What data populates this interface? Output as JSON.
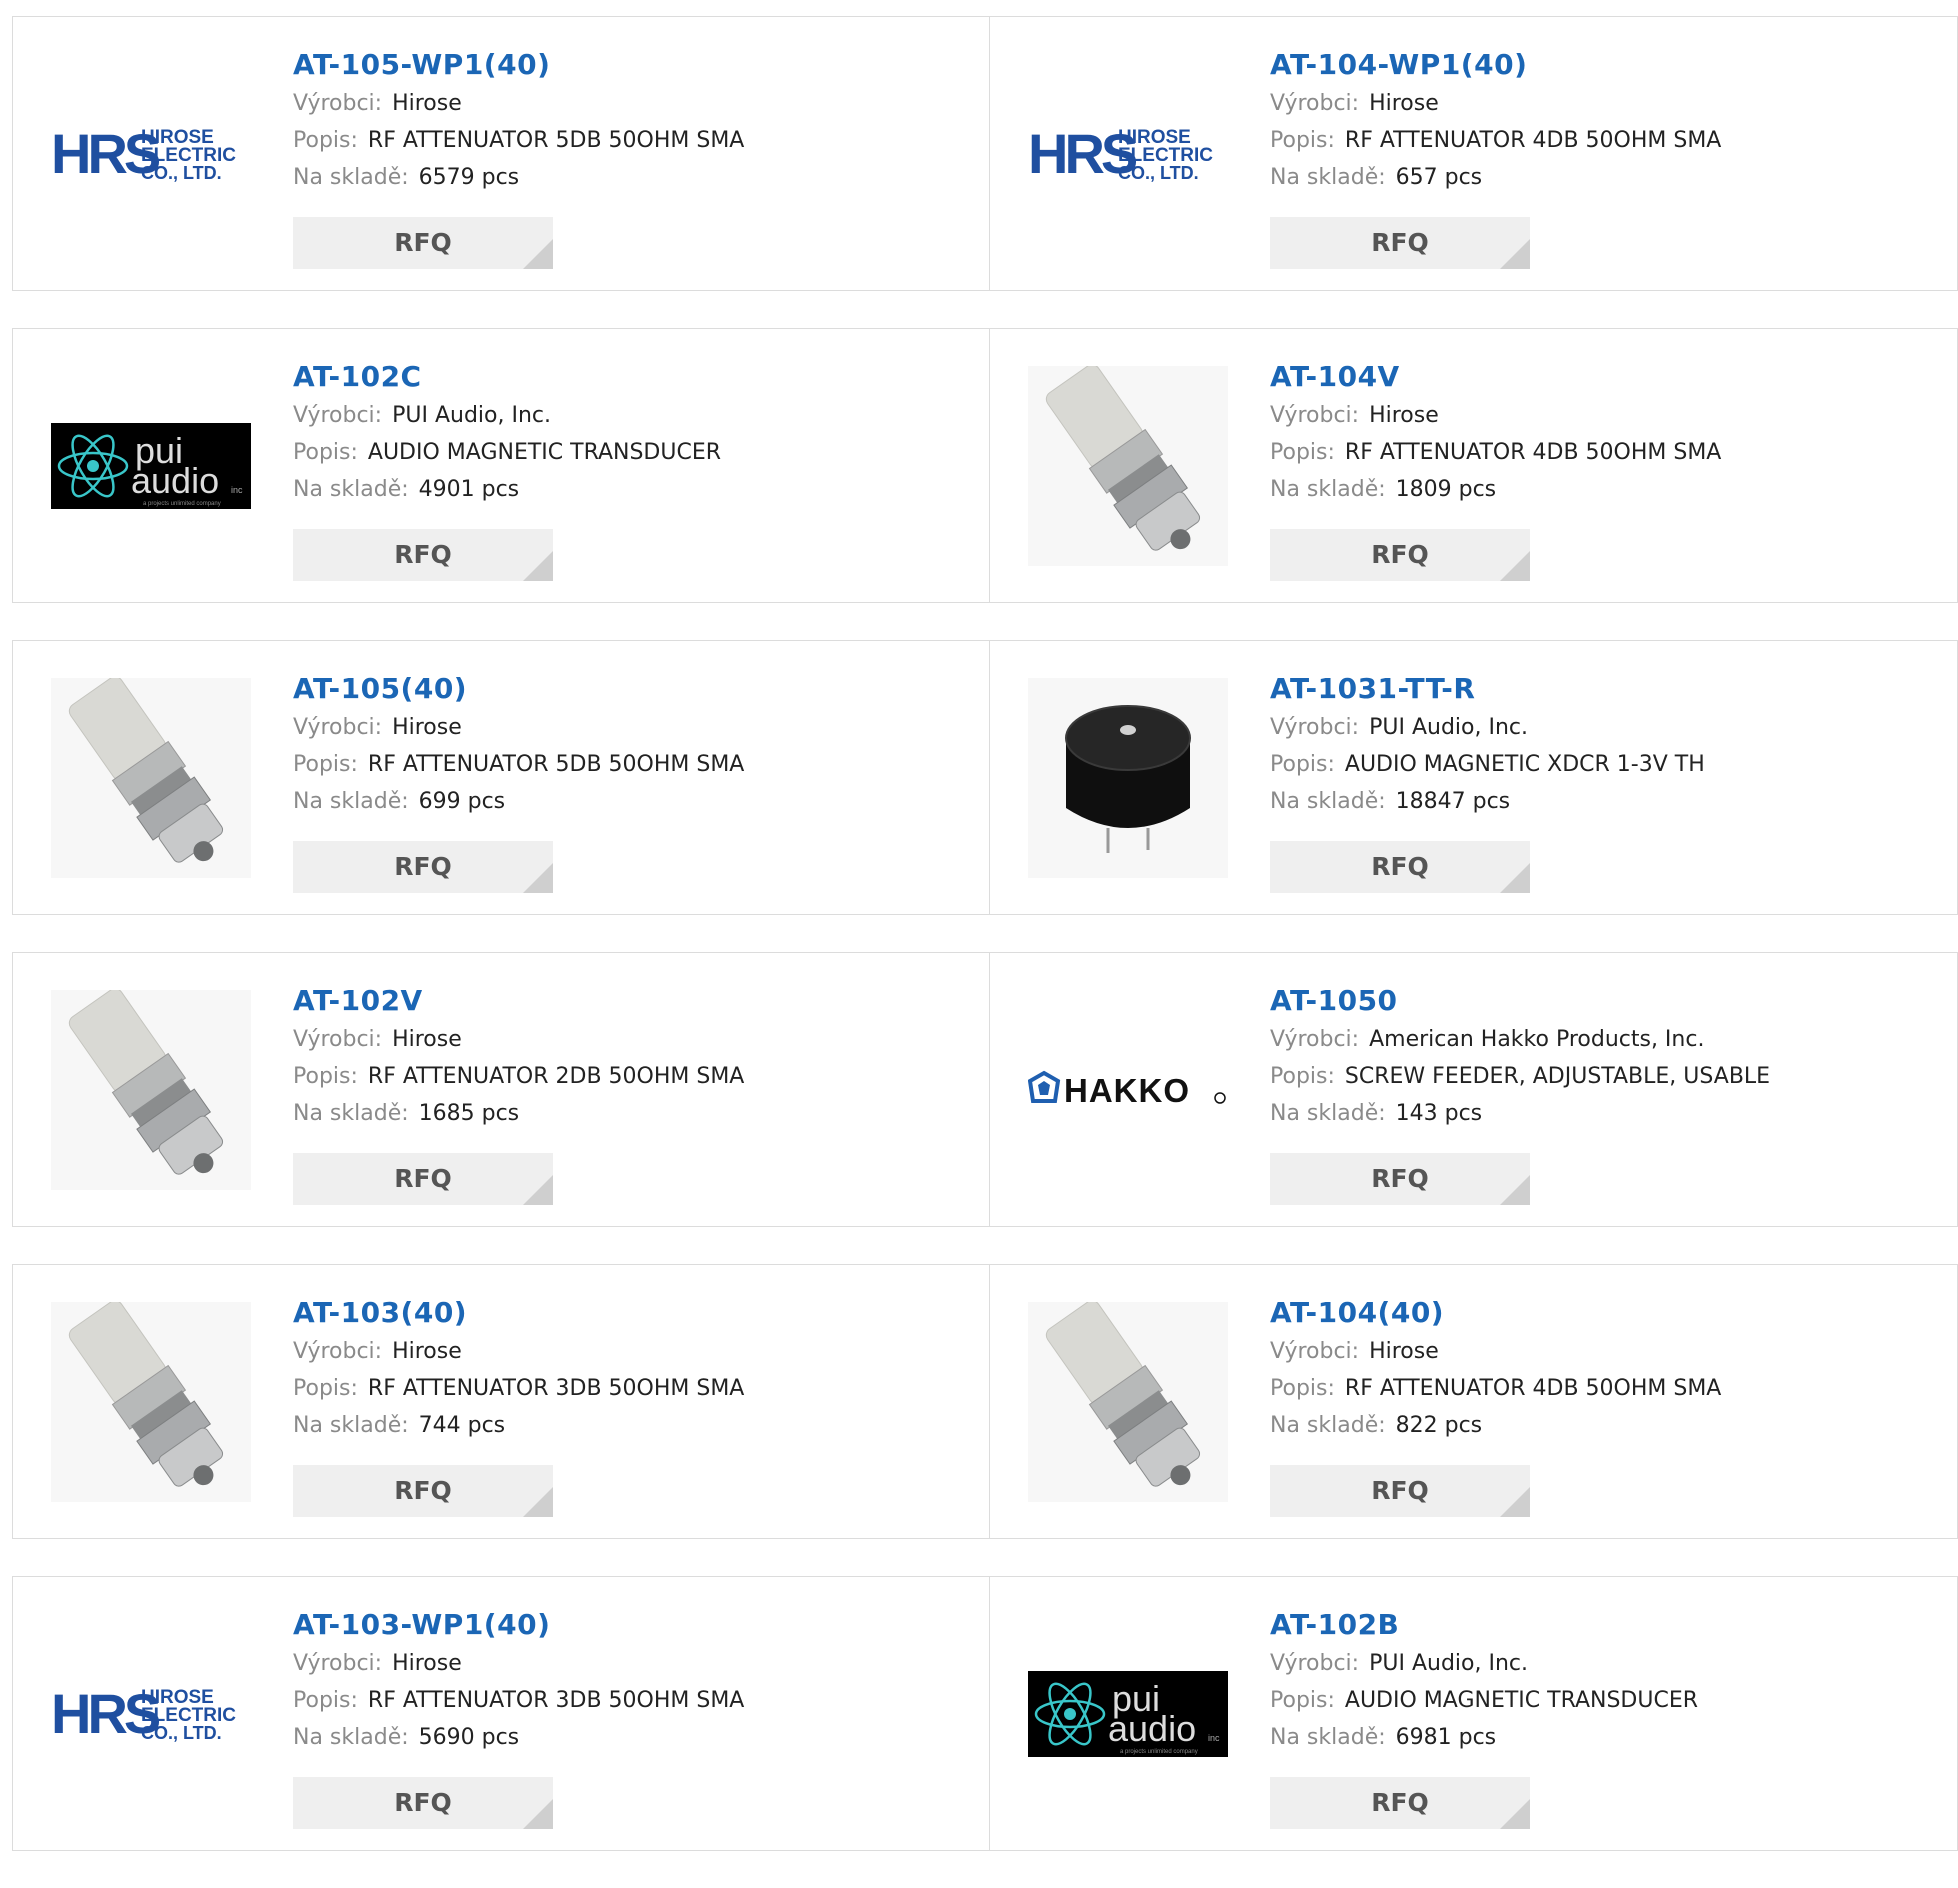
{
  "labels": {
    "manufacturer": "Výrobci:",
    "description": "Popis:",
    "stock": "Na skladě:",
    "rfq": "RFQ"
  },
  "logo_text": {
    "hrs_mark": "HRS",
    "hrs_line1": "HIROSE",
    "hrs_line2": "ELECTRIC",
    "hrs_line3": "CO., LTD.",
    "pui_line1": "pui",
    "pui_line2": "audio",
    "pui_inc": "inc",
    "pui_tagline": "a projects unlimited company",
    "hakko": "HAKKO"
  },
  "products": [
    {
      "part": "AT-105-WP1(40)",
      "manufacturer": "Hirose",
      "description": "RF ATTENUATOR 5DB 50OHM SMA",
      "stock": "6579 pcs",
      "image": "hrs-logo"
    },
    {
      "part": "AT-104-WP1(40)",
      "manufacturer": "Hirose",
      "description": "RF ATTENUATOR 4DB 50OHM SMA",
      "stock": "657 pcs",
      "image": "hrs-logo"
    },
    {
      "part": "AT-102C",
      "manufacturer": "PUI Audio, Inc.",
      "description": "AUDIO MAGNETIC TRANSDUCER",
      "stock": "4901 pcs",
      "image": "pui-logo"
    },
    {
      "part": "AT-104V",
      "manufacturer": "Hirose",
      "description": "RF ATTENUATOR 4DB 50OHM SMA",
      "stock": "1809 pcs",
      "image": "attenuator-photo"
    },
    {
      "part": "AT-105(40)",
      "manufacturer": "Hirose",
      "description": "RF ATTENUATOR 5DB 50OHM SMA",
      "stock": "699 pcs",
      "image": "attenuator-photo"
    },
    {
      "part": "AT-1031-TT-R",
      "manufacturer": "PUI Audio, Inc.",
      "description": "AUDIO MAGNETIC XDCR 1-3V TH",
      "stock": "18847 pcs",
      "image": "buzzer-photo"
    },
    {
      "part": "AT-102V",
      "manufacturer": "Hirose",
      "description": "RF ATTENUATOR 2DB 50OHM SMA",
      "stock": "1685 pcs",
      "image": "attenuator-photo"
    },
    {
      "part": "AT-1050",
      "manufacturer": "American Hakko Products, Inc.",
      "description": "SCREW FEEDER, ADJUSTABLE, USABLE",
      "stock": "143 pcs",
      "image": "hakko-logo"
    },
    {
      "part": "AT-103(40)",
      "manufacturer": "Hirose",
      "description": "RF ATTENUATOR 3DB 50OHM SMA",
      "stock": "744 pcs",
      "image": "attenuator-photo"
    },
    {
      "part": "AT-104(40)",
      "manufacturer": "Hirose",
      "description": "RF ATTENUATOR 4DB 50OHM SMA",
      "stock": "822 pcs",
      "image": "attenuator-photo"
    },
    {
      "part": "AT-103-WP1(40)",
      "manufacturer": "Hirose",
      "description": "RF ATTENUATOR 3DB 50OHM SMA",
      "stock": "5690 pcs",
      "image": "hrs-logo"
    },
    {
      "part": "AT-102B",
      "manufacturer": "PUI Audio, Inc.",
      "description": "AUDIO MAGNETIC TRANSDUCER",
      "stock": "6981 pcs",
      "image": "pui-logo"
    }
  ],
  "colors": {
    "title_link": "#1b66b5",
    "label_gray": "#8a8a8a",
    "border": "#dcdcdc",
    "rfq_bg": "#efefef",
    "hrs_blue": "#1f4fa0",
    "pui_teal": "#39c6c9"
  }
}
